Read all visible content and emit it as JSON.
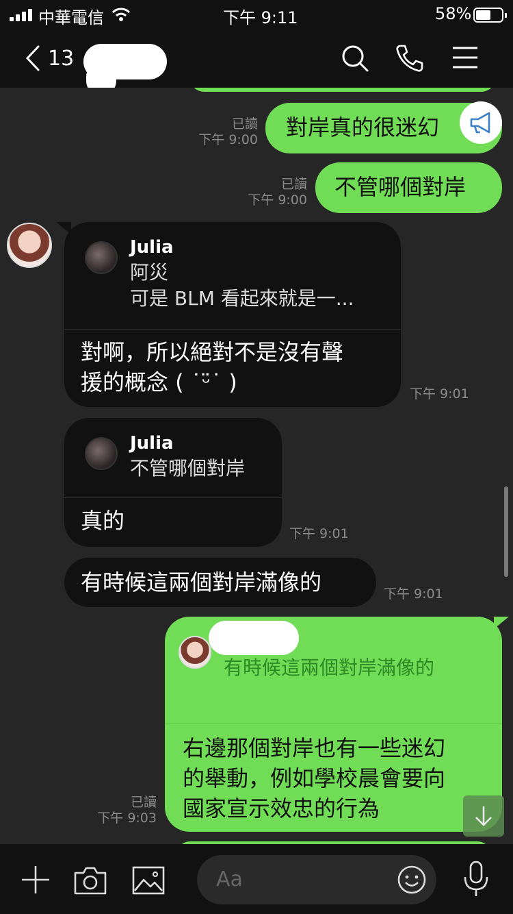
{
  "status_bar": {
    "carrier": "中華電信",
    "time": "下午 9:11",
    "battery_percent": "58%",
    "battery_level": 0.58
  },
  "header": {
    "unread_count": "13",
    "icons": [
      "search-icon",
      "phone-icon",
      "menu-icon"
    ]
  },
  "messages": {
    "m1": {
      "text": "對岸真的很迷幻",
      "read": "已讀",
      "time": "下午 9:00"
    },
    "m2": {
      "text": "不管哪個對岸",
      "read": "已讀",
      "time": "下午 9:00"
    },
    "m3": {
      "quote_name": "Julia",
      "quote_line1": "阿災",
      "quote_line2": "可是 BLM 看起來就是一...",
      "line1": "對啊，所以絕對不是沒有聲",
      "line2": "援的概念 ( ˙ᵕ̈˙ )",
      "time": "下午 9:01"
    },
    "m4": {
      "quote_name": "Julia",
      "quote_line1": "不管哪個對岸",
      "text": "真的",
      "time": "下午 9:01"
    },
    "m5": {
      "text": "有時候這兩個對岸滿像的",
      "time": "下午 9:01"
    },
    "m6": {
      "quote_text": "有時候這兩個對岸滿像的",
      "line1": "右邊那個對岸也有一些迷幻",
      "line2": "的舉動，例如學校晨會要向",
      "line3": "國家宣示效忠的行為",
      "read": "已讀",
      "time": "下午 9:03"
    }
  },
  "input": {
    "placeholder": "Aa"
  },
  "colors": {
    "sent_bubble": "#71dd56",
    "received_bubble": "#111111",
    "background": "#262626"
  }
}
